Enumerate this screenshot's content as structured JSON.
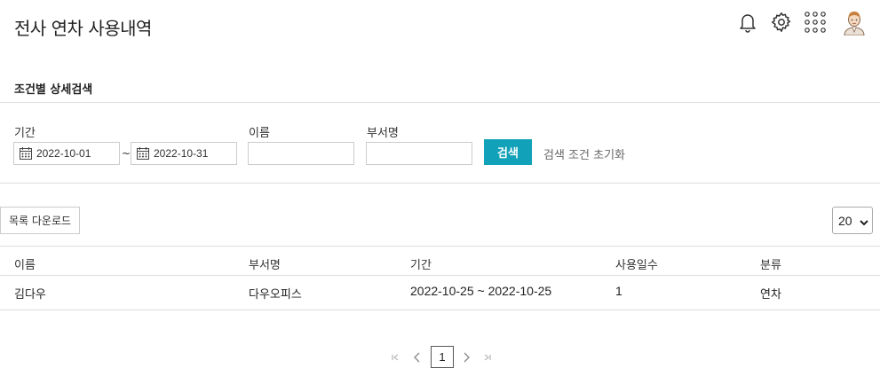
{
  "header": {
    "title": "전사 연차 사용내역",
    "icons": [
      "bell-icon",
      "gear-icon",
      "apps-grid-icon",
      "user-avatar"
    ]
  },
  "search": {
    "section_title": "조건별 상세검색",
    "period_label": "기간",
    "start_date": "2022-10-01",
    "range_separator": "~",
    "end_date": "2022-10-31",
    "name_label": "이름",
    "name_value": "",
    "dept_label": "부서명",
    "dept_value": "",
    "search_button": "검색",
    "reset_link": "검색 조건 초기화"
  },
  "toolbar": {
    "download_button": "목록 다운로드",
    "page_size": "20"
  },
  "table": {
    "headers": [
      "이름",
      "부서명",
      "기간",
      "사용일수",
      "분류"
    ],
    "rows": [
      [
        "김다우",
        "다우오피스",
        "2022-10-25 ~ 2022-10-25",
        "1",
        "연차"
      ]
    ]
  },
  "pagination": {
    "current_page": "1"
  },
  "colors": {
    "accent": "#11a1b9",
    "border": "#dddddd"
  }
}
